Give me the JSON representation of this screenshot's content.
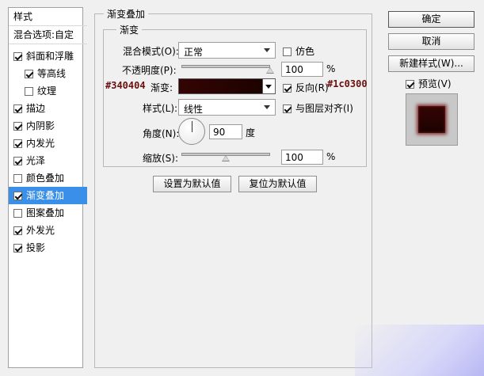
{
  "left_panel": {
    "header": "样式",
    "blend_options": "混合选项:自定",
    "items": [
      {
        "label": "斜面和浮雕",
        "checked": true,
        "sub": false,
        "selected": false
      },
      {
        "label": "等高线",
        "checked": true,
        "sub": true,
        "selected": false
      },
      {
        "label": "纹理",
        "checked": false,
        "sub": true,
        "selected": false
      },
      {
        "label": "描边",
        "checked": true,
        "sub": false,
        "selected": false
      },
      {
        "label": "内阴影",
        "checked": true,
        "sub": false,
        "selected": false
      },
      {
        "label": "内发光",
        "checked": true,
        "sub": false,
        "selected": false
      },
      {
        "label": "光泽",
        "checked": true,
        "sub": false,
        "selected": false
      },
      {
        "label": "颜色叠加",
        "checked": false,
        "sub": false,
        "selected": false
      },
      {
        "label": "渐变叠加",
        "checked": true,
        "sub": false,
        "selected": true
      },
      {
        "label": "图案叠加",
        "checked": false,
        "sub": false,
        "selected": false
      },
      {
        "label": "外发光",
        "checked": true,
        "sub": false,
        "selected": false
      },
      {
        "label": "投影",
        "checked": true,
        "sub": false,
        "selected": false
      }
    ]
  },
  "gradient_overlay": {
    "title": "渐变叠加",
    "group_title": "渐变",
    "blend_mode_label": "混合模式(O):",
    "blend_mode_value": "正常",
    "dither_label": "仿色",
    "dither_checked": false,
    "opacity_label": "不透明度(P):",
    "opacity_value": "100",
    "opacity_level": 1.0,
    "opacity_unit": "%",
    "gradient_label": "渐变:",
    "gradient_start_color": "#340404",
    "gradient_end_color": "#1c0300",
    "reverse_label": "反向(R)",
    "reverse_checked": true,
    "style_label": "样式(L):",
    "style_value": "线性",
    "align_label": "与图层对齐(I)",
    "align_checked": true,
    "angle_label": "角度(N):",
    "angle_value": "90",
    "angle_unit": "度",
    "scale_label": "缩放(S):",
    "scale_value": "100",
    "scale_level": 0.5,
    "scale_unit": "%",
    "set_default_label": "设置为默认值",
    "reset_default_label": "复位为默认值"
  },
  "annotations": {
    "start_color_note": "#340404",
    "end_color_note": "#1c0300"
  },
  "right_panel": {
    "ok_label": "确定",
    "cancel_label": "取消",
    "new_style_label": "新建样式(W)...",
    "preview_label": "预览(V)",
    "preview_checked": true
  },
  "colors": {
    "selection": "#3a8fe8",
    "annotation_text": "#6b0f0f",
    "preview_swatch": "#340404"
  }
}
